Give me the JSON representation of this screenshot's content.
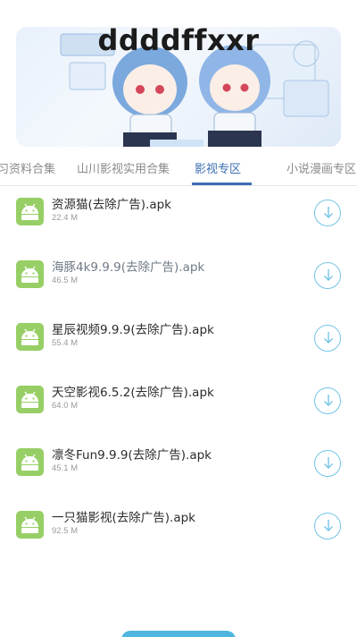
{
  "banner": {
    "title": "ddddffxxr"
  },
  "tabs": [
    {
      "label": "习资料合集",
      "active": false
    },
    {
      "label": "山川影视实用合集",
      "active": false
    },
    {
      "label": "影视专区",
      "active": true
    },
    {
      "label": "小说漫画专区",
      "active": false
    }
  ],
  "files": [
    {
      "name": "资源猫(去除广告).apk",
      "size": "22.4 M"
    },
    {
      "name": "海豚4k9.9.9(去除广告).apk",
      "size": "46.5 M"
    },
    {
      "name": "星辰视频9.9.9(去除广告).apk",
      "size": "55.4 M"
    },
    {
      "name": "天空影视6.5.2(去除广告).apk",
      "size": "64.0 M"
    },
    {
      "name": "凛冬Fun9.9.9(去除广告).apk",
      "size": "45.1 M"
    },
    {
      "name": "一只猫影视(去除广告).apk",
      "size": "92.5 M"
    }
  ],
  "colors": {
    "accent": "#3b6fb3",
    "icon_bg": "#97cf66",
    "download": "#74c4e6"
  },
  "icons": {
    "file": "android-icon",
    "action": "download-icon"
  }
}
